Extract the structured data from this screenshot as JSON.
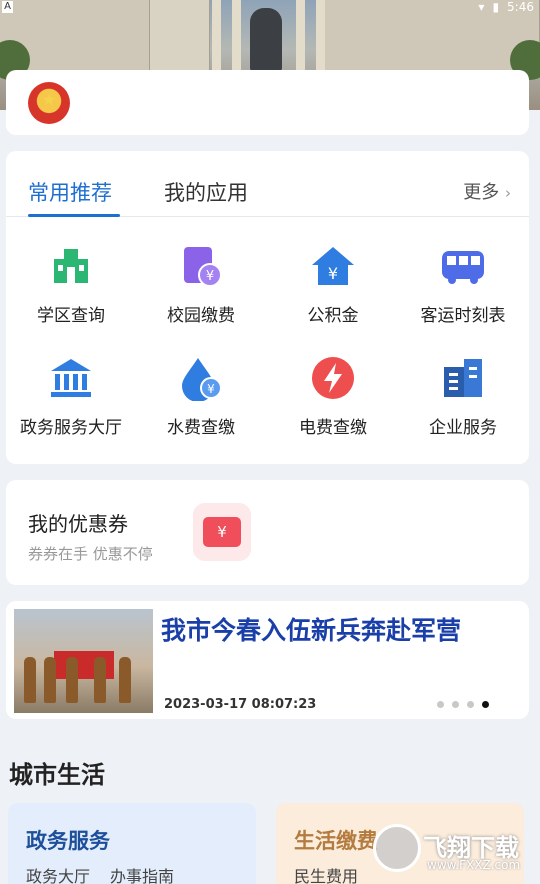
{
  "status_bar": {
    "time": "5:46",
    "notif": "A"
  },
  "recommend": {
    "tabs": [
      "常用推荐",
      "我的应用"
    ],
    "more_label": "更多",
    "items": [
      {
        "label": "学区查询",
        "icon": "school-icon",
        "color": "#2bb673"
      },
      {
        "label": "校园缴费",
        "icon": "campus-pay-icon",
        "color": "#8a63e8"
      },
      {
        "label": "公积金",
        "icon": "housing-fund-icon",
        "color": "#2f7de1"
      },
      {
        "label": "客运时刻表",
        "icon": "bus-icon",
        "color": "#4f6ce8"
      },
      {
        "label": "政务服务大厅",
        "icon": "government-hall-icon",
        "color": "#2f7de1"
      },
      {
        "label": "水费查缴",
        "icon": "water-bill-icon",
        "color": "#2f7de1"
      },
      {
        "label": "电费查缴",
        "icon": "electricity-bill-icon",
        "color": "#ef4e4e"
      },
      {
        "label": "企业服务",
        "icon": "enterprise-icon",
        "color": "#2a5dab"
      }
    ]
  },
  "coupon": {
    "title": "我的优惠券",
    "subtitle": "券券在手 优惠不停",
    "icon_text": "¥"
  },
  "news": {
    "title": "我市今春入伍新兵奔赴军营",
    "date": "2023-03-17 08:07:23",
    "image_banner": "百色市今春入伍新兵奔赴军营"
  },
  "city_life": {
    "title": "城市生活",
    "cards": [
      {
        "title": "政务服务",
        "links": [
          "政务大厅",
          "办事指南"
        ]
      },
      {
        "title": "生活缴费",
        "links": [
          "民生费用"
        ]
      }
    ]
  },
  "watermark": {
    "brand": "飞翔下载",
    "url": "www.FXXZ.com"
  }
}
